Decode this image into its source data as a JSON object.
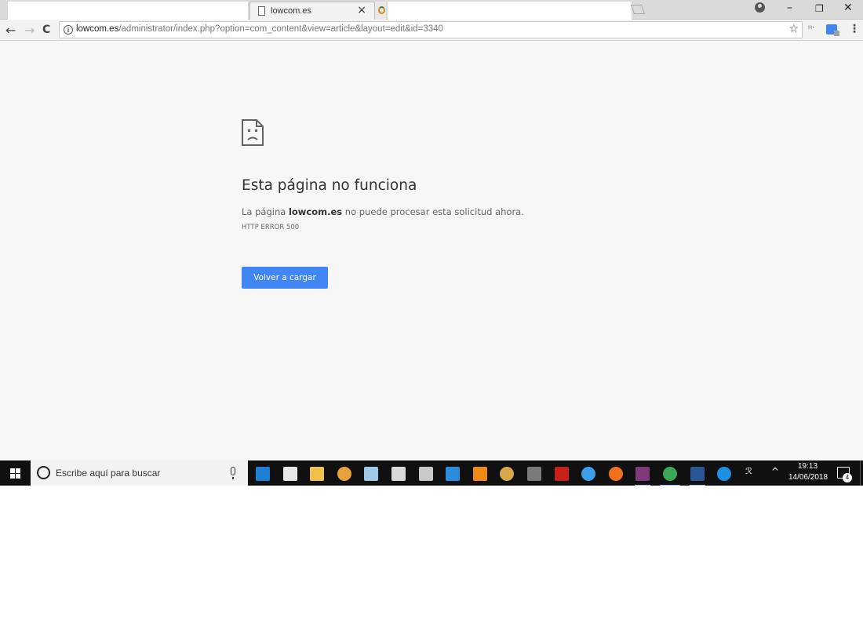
{
  "browser": {
    "active_tab_title": "lowcom.es",
    "tab_close_glyph": "×",
    "url_host": "lowcom.es",
    "url_path": "/administrator/index.php?option=com_content&view=article&layout=edit&id=3340",
    "window_controls": {
      "minimize": "–",
      "restore": "❐",
      "close": "✕"
    },
    "nav": {
      "back": "←",
      "forward": "→",
      "reload": "C"
    },
    "star_glyph": "☆",
    "menu_glyph": "⋮"
  },
  "error_page": {
    "title": "Esta página no funciona",
    "desc_prefix": "La página ",
    "desc_host": "lowcom.es",
    "desc_suffix": " no puede procesar esta solicitud ahora.",
    "error_code": "HTTP ERROR 500",
    "reload_label": "Volver a cargar"
  },
  "taskbar": {
    "search_placeholder": "Escribe aquí para buscar",
    "apps": [
      {
        "name": "edge-icon",
        "color": "#1e7fd6"
      },
      {
        "name": "store-icon",
        "color": "#e8e8e8"
      },
      {
        "name": "file-explorer-icon",
        "color": "#f0c24b"
      },
      {
        "name": "photos-app-icon",
        "color": "#e8a23a"
      },
      {
        "name": "paint-icon",
        "color": "#9ec7e8"
      },
      {
        "name": "calculator-icon",
        "color": "#d9d9d9"
      },
      {
        "name": "movie-maker-icon",
        "color": "#c9c9c9"
      },
      {
        "name": "teamviewer-icon",
        "color": "#2a8ee0"
      },
      {
        "name": "vlc-icon",
        "color": "#f08a16"
      },
      {
        "name": "media-player-icon",
        "color": "#d8a848"
      },
      {
        "name": "filezilla-server-icon",
        "color": "#7a7a7a"
      },
      {
        "name": "filezilla-icon",
        "color": "#c8211b"
      },
      {
        "name": "internet-explorer-icon",
        "color": "#3b9ee8"
      },
      {
        "name": "firefox-icon",
        "color": "#f26f1e"
      },
      {
        "name": "onenote-icon",
        "color": "#80397b"
      },
      {
        "name": "chrome-icon",
        "color": "#3aa757"
      },
      {
        "name": "word-icon",
        "color": "#2b5797"
      },
      {
        "name": "help-icon",
        "color": "#1e90e0"
      }
    ],
    "clock_time": "19:13",
    "clock_date": "14/06/2018",
    "notification_count": "4",
    "tray_chevron": "^",
    "tray_people": "ℛ"
  }
}
